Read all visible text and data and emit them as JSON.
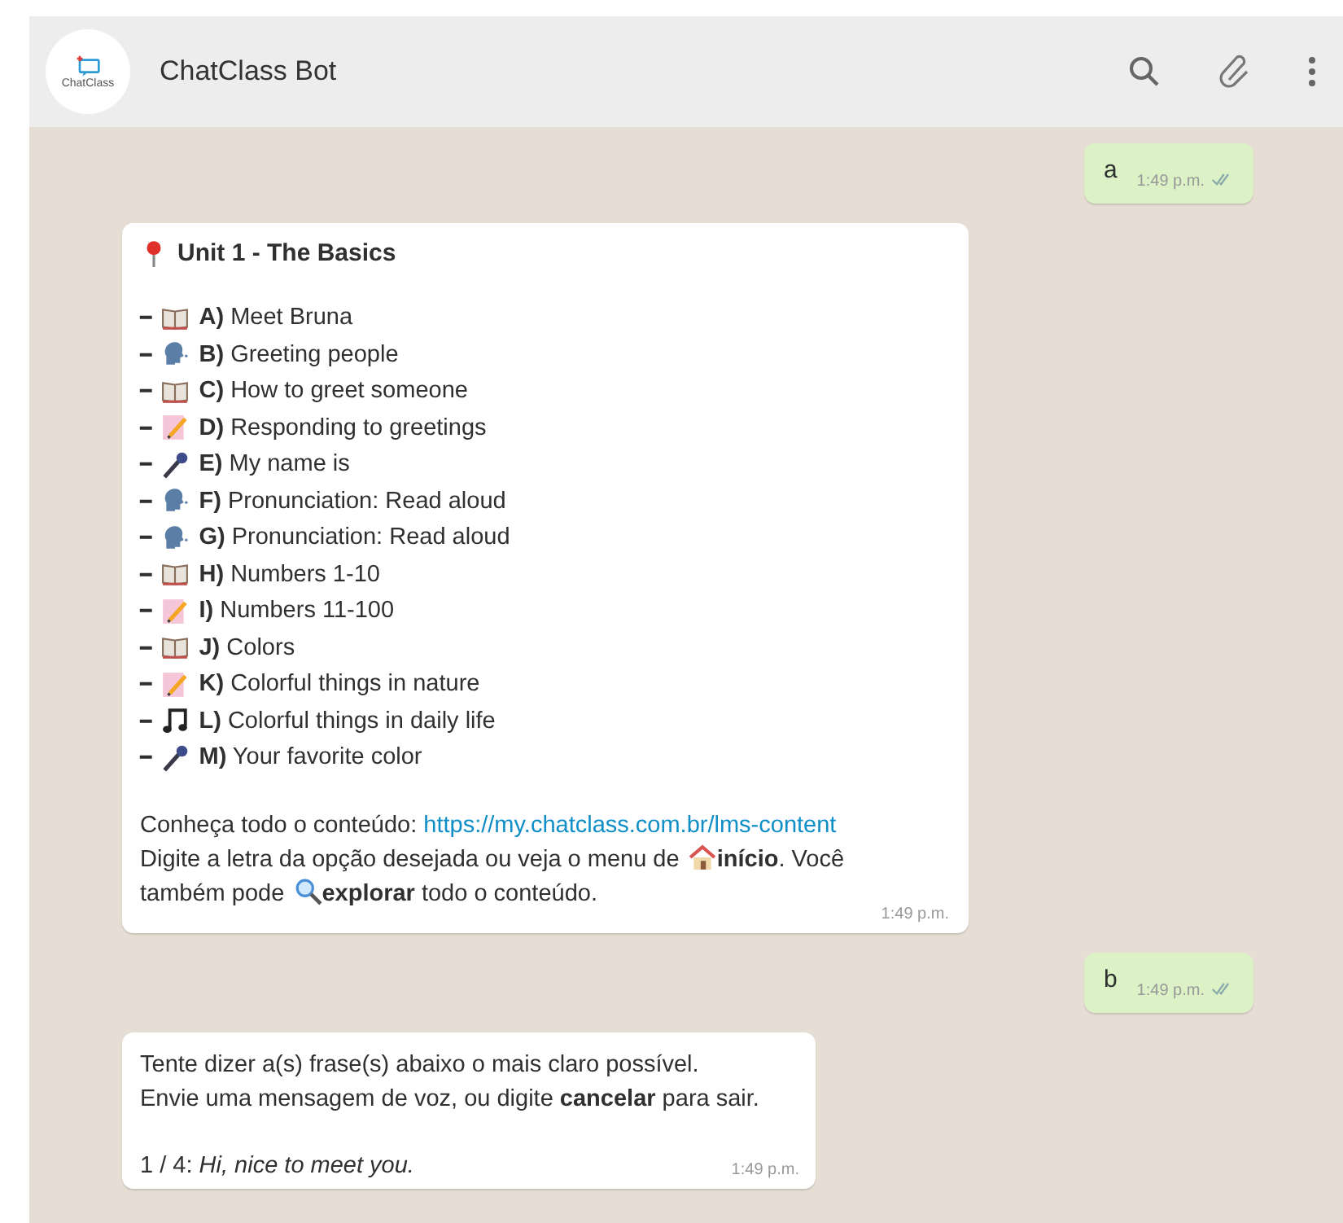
{
  "header": {
    "avatar_text": "ChatClass",
    "title": "ChatClass Bot"
  },
  "messages": [
    {
      "kind": "text",
      "outgoing": true,
      "text": "a",
      "time": "1:49 p.m.",
      "read": true
    },
    {
      "kind": "menu",
      "outgoing": false,
      "title": "Unit 1 - The Basics",
      "items": [
        {
          "bullet": "━",
          "kind": "book",
          "letter": "A)",
          "label": "Meet Bruna"
        },
        {
          "bullet": "━",
          "kind": "speech",
          "letter": "B)",
          "label": "Greeting people"
        },
        {
          "bullet": "━",
          "kind": "book",
          "letter": "C)",
          "label": "How to greet someone"
        },
        {
          "bullet": "━",
          "kind": "memo",
          "letter": "D)",
          "label": "Responding to greetings"
        },
        {
          "bullet": "━",
          "kind": "mic",
          "letter": "E)",
          "label": "My name is"
        },
        {
          "bullet": "━",
          "kind": "speech",
          "letter": "F)",
          "label": "Pronunciation: Read aloud"
        },
        {
          "bullet": "━",
          "kind": "speech",
          "letter": "G)",
          "label": "Pronunciation: Read aloud"
        },
        {
          "bullet": "━",
          "kind": "book",
          "letter": "H)",
          "label": "Numbers 1-10"
        },
        {
          "bullet": "━",
          "kind": "memo",
          "letter": "I)",
          "label": "Numbers 11-100"
        },
        {
          "bullet": "━",
          "kind": "book",
          "letter": "J)",
          "label": "Colors"
        },
        {
          "bullet": "━",
          "kind": "memo",
          "letter": "K)",
          "label": "Colorful things in nature"
        },
        {
          "bullet": "━",
          "kind": "music",
          "letter": "L)",
          "label": "Colorful things in daily life"
        },
        {
          "bullet": "━",
          "kind": "mic",
          "letter": "M)",
          "label": "Your favorite color"
        }
      ],
      "intro": "Conheça todo o conteúdo: ",
      "link": "https://my.chatclass.com.br/lms-content",
      "segments": [
        {
          "kind": "text",
          "text": "Digite a letra da opção desejada ou veja o menu de"
        },
        {
          "kind": "house"
        },
        {
          "kind": "text",
          "text": "**início**. Você"
        },
        {
          "kind": "text",
          "text": "também pode"
        },
        {
          "kind": "search"
        },
        {
          "kind": "text",
          "text": "**explorar** todo o conteúdo."
        }
      ],
      "time": "1:49 p.m."
    },
    {
      "kind": "text",
      "outgoing": true,
      "text": "b",
      "time": "1:49 p.m.",
      "read": true
    },
    {
      "kind": "paragraphs",
      "outgoing": false,
      "paragraphs": [
        "Tente dizer a(s) frase(s) abaixo o mais claro possível.\nEnvie uma mensagem de voz, ou digite **cancelar** para sair.",
        "1 / 4: *Hi, nice to meet you.*"
      ],
      "time": "1:49 p.m."
    }
  ]
}
